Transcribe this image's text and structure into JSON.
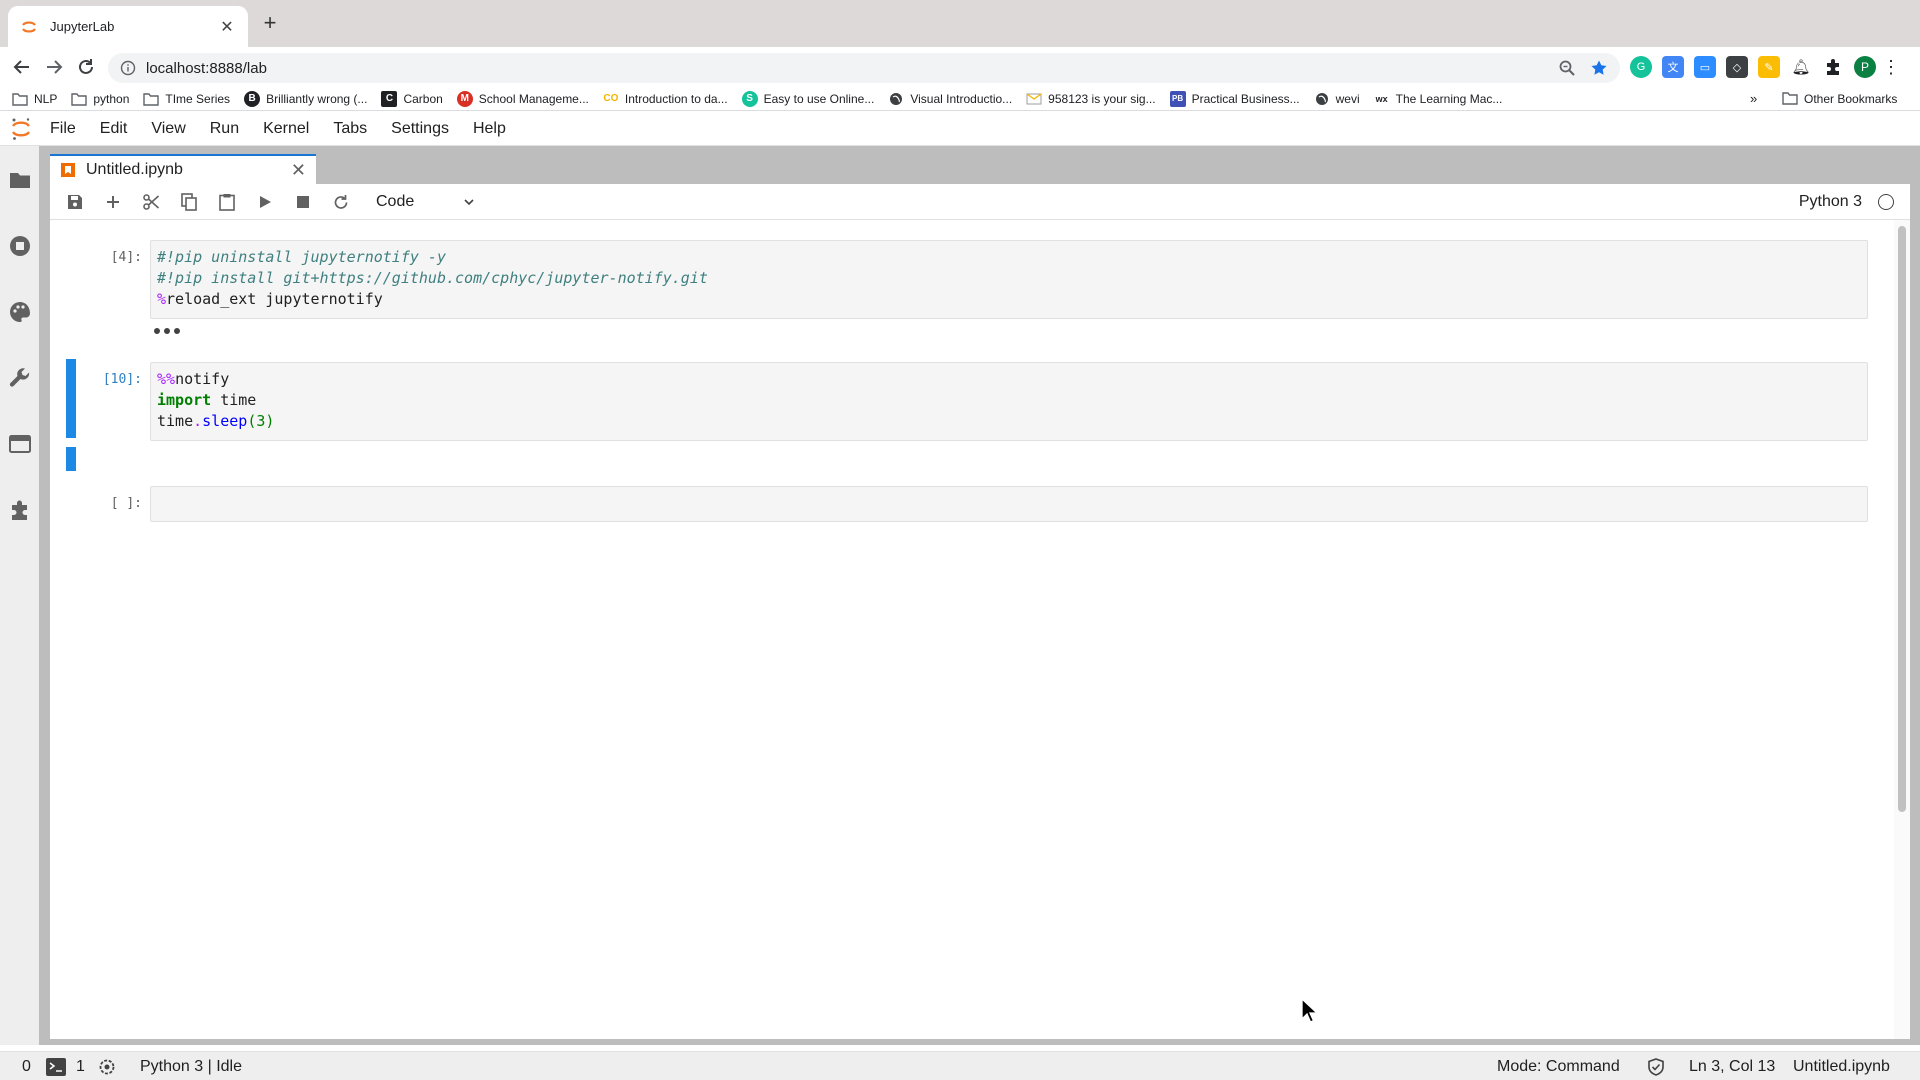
{
  "browser": {
    "tab_title": "JupyterLab",
    "url": "localhost:8888/lab",
    "profile_initial": "P"
  },
  "bookmarks": {
    "items": [
      {
        "label": "NLP",
        "icon": "folder-icon"
      },
      {
        "label": "python",
        "icon": "folder-icon"
      },
      {
        "label": "TIme Series",
        "icon": "folder-icon"
      },
      {
        "label": "Brilliantly wrong (...",
        "icon": "b-logo-icon"
      },
      {
        "label": "Carbon",
        "icon": "carbon-logo-icon"
      },
      {
        "label": "School Manageme...",
        "icon": "m-logo-icon"
      },
      {
        "label": "Introduction to da...",
        "icon": "co-logo-icon"
      },
      {
        "label": "Easy to use Online...",
        "icon": "s-logo-icon"
      },
      {
        "label": "Visual Introductio...",
        "icon": "globe-icon"
      },
      {
        "label": "958123 is your sig...",
        "icon": "mail-icon"
      },
      {
        "label": "Practical Business...",
        "icon": "pb-logo-icon"
      },
      {
        "label": "wevi",
        "icon": "globe-icon"
      },
      {
        "label": "The Learning Mac...",
        "icon": "wix-logo-icon"
      }
    ],
    "more": "»",
    "other": "Other Bookmarks"
  },
  "menu": {
    "items": [
      "File",
      "Edit",
      "View",
      "Run",
      "Kernel",
      "Tabs",
      "Settings",
      "Help"
    ]
  },
  "notebook": {
    "tab_title": "Untitled.ipynb",
    "cell_type": "Code",
    "kernel": "Python 3",
    "cells": [
      {
        "prompt": "[4]:",
        "lines": [
          "#!pip uninstall jupyternotify -y",
          "#!pip install git+https://github.com/cphyc/jupyter-notify.git",
          "%reload_ext jupyternotify"
        ]
      },
      {
        "prompt": "[10]:",
        "lines": [
          "%%notify",
          "import time",
          "time.sleep(3)"
        ]
      },
      {
        "prompt": "[ ]:",
        "lines": [
          ""
        ]
      }
    ]
  },
  "status": {
    "left_count": "0",
    "terminal_count": "1",
    "kernel_status": "Python 3 | Idle",
    "mode": "Mode: Command",
    "position": "Ln 3, Col 13",
    "file": "Untitled.ipynb"
  },
  "colors": {
    "jupyter_orange": "#f37726",
    "active_blue": "#1e88e5",
    "star_blue": "#1a73e8"
  }
}
